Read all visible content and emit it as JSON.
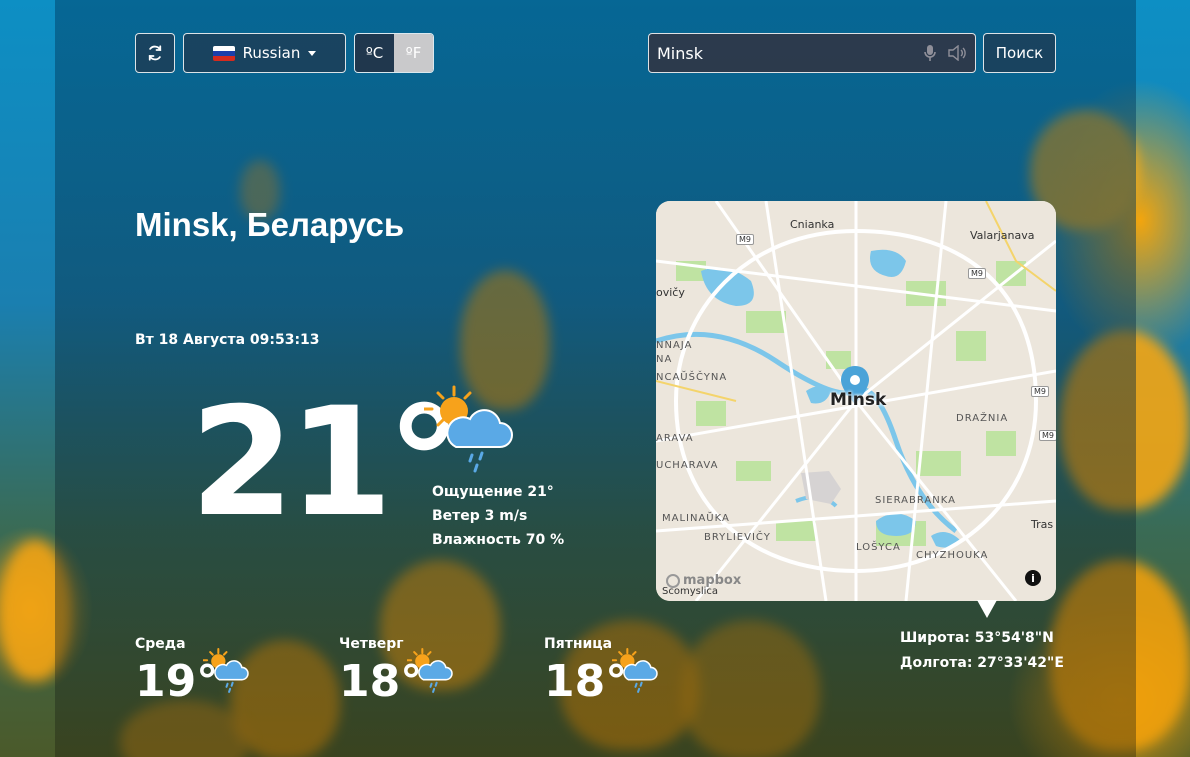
{
  "header": {
    "refresh_label": "",
    "language": {
      "selected": "Russian",
      "flag": "russia-flag"
    },
    "units": {
      "celsius": "ºC",
      "fahrenheit": "ºF",
      "active": "celsius"
    },
    "search": {
      "value": "Minsk",
      "placeholder": "",
      "button_label": "Поиск"
    }
  },
  "location": {
    "city": "Minsk",
    "country": "Беларусь"
  },
  "datetime": {
    "date": "Вт 18 Августа",
    "time": "09:53:13"
  },
  "current": {
    "temperature": "21°",
    "icon": "partly-cloudy-rain-icon",
    "feels_like": "Ощущение 21°",
    "wind": "Ветер 3 m/s",
    "humidity": "Влажность 70 %"
  },
  "forecast": [
    {
      "day": "Среда",
      "temp": "19°",
      "icon": "partly-cloudy-rain-icon"
    },
    {
      "day": "Четверг",
      "temp": "18°",
      "icon": "partly-cloudy-rain-icon"
    },
    {
      "day": "Пятница",
      "temp": "18°",
      "icon": "partly-cloudy-rain-icon"
    }
  ],
  "map": {
    "center_label": "Minsk",
    "attribution": "mapbox",
    "labels": {
      "n": "Cnianka",
      "ne": "Valarjanava",
      "w1": "ovičy",
      "w2": "NNAJA",
      "w3": "NA",
      "w4": "NCAŬŠČYNA",
      "e1": "DRAŽNIA",
      "w5": "ARAVA",
      "w6": "UCHARAVA",
      "se1": "SIERABRANKA",
      "sw1": "MALINAŬKA",
      "sw2": "BRYLIEVIČY",
      "s1": "LOŠYCA",
      "s2": "CHYZHOUKA",
      "e2": "Tras",
      "s3": "Scomyslica",
      "m9a": "M9",
      "m9b": "M9",
      "m9c": "M9",
      "m9d": "M9"
    }
  },
  "coordinates": {
    "latitude": "Широта: 53°54'8\"N",
    "longitude": "Долгота: 27°33'42\"E"
  },
  "colors": {
    "accent_sun": "#f7a21b",
    "cloud": "#5aa9e6",
    "map_water": "#7cc6ea",
    "map_park": "#bfe3a2",
    "pin": "#4aa3d8"
  }
}
